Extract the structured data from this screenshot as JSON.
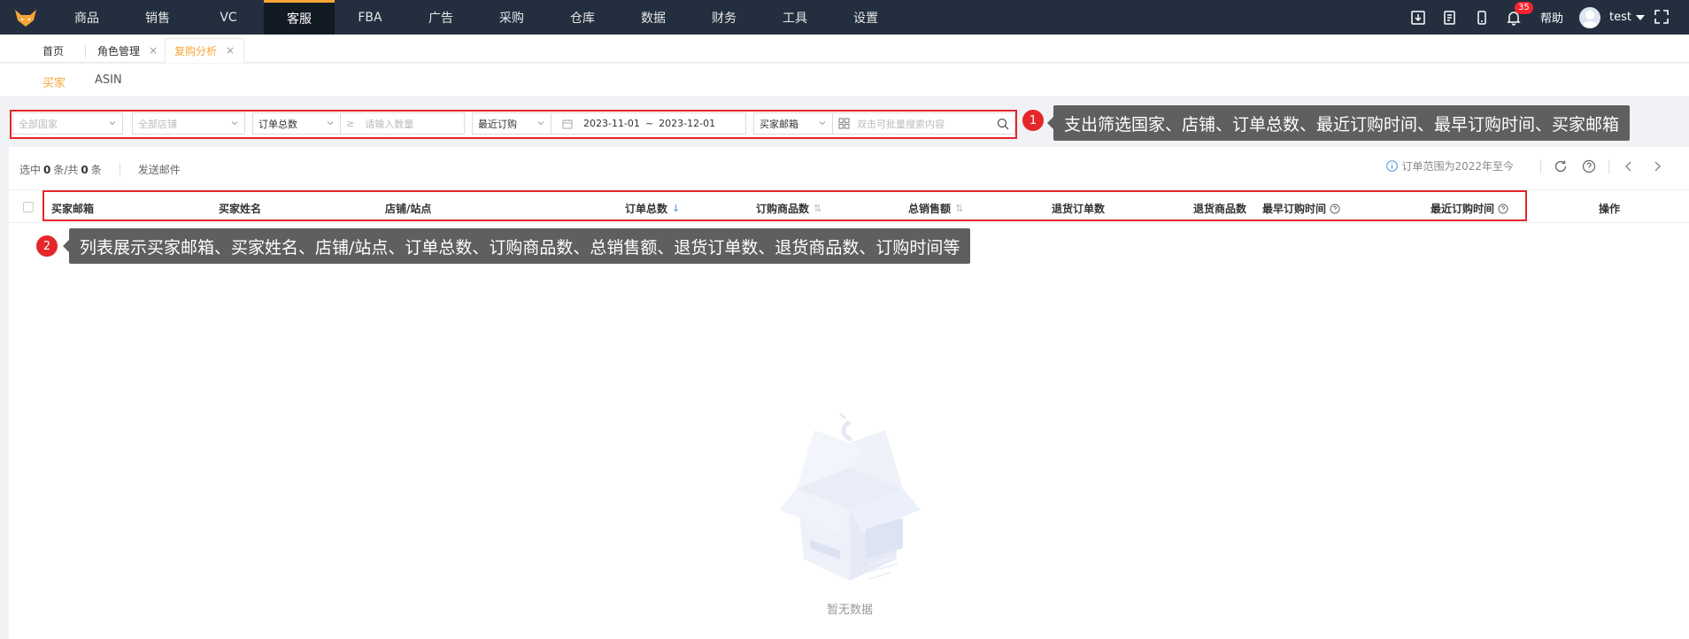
{
  "topnav": {
    "items": [
      {
        "label": "商品"
      },
      {
        "label": "销售"
      },
      {
        "label": "VC"
      },
      {
        "label": "客服",
        "active": true
      },
      {
        "label": "FBA"
      },
      {
        "label": "广告"
      },
      {
        "label": "采购"
      },
      {
        "label": "仓库"
      },
      {
        "label": "数据"
      },
      {
        "label": "财务"
      },
      {
        "label": "工具"
      },
      {
        "label": "设置"
      }
    ],
    "notification_count": "35",
    "help_label": "帮助",
    "username": "test",
    "accent_color": "#f7a535",
    "bg_color": "#232f3e"
  },
  "tabs": {
    "home": "首页",
    "role": "角色管理",
    "repurchase": "复购分析",
    "close_glyph": "×"
  },
  "subtabs": {
    "buyer": "买家",
    "asin": "ASIN"
  },
  "filters": {
    "country_placeholder": "全部国家",
    "store_placeholder": "全部店铺",
    "order_total": "订单总数",
    "gte": "≥",
    "quantity_placeholder": "请输入数量",
    "recent_purchase": "最近订购",
    "date_start": "2023-11-01",
    "date_sep": "~",
    "date_end": "2023-12-01",
    "buyer_email": "买家邮箱",
    "search_placeholder": "双击可批量搜索内容"
  },
  "annotations": {
    "one_number": "1",
    "one_text": "支出筛选国家、店铺、订单总数、最近订购时间、最早订购时间、买家邮箱",
    "two_number": "2",
    "two_text": "列表展示买家邮箱、买家姓名、店铺/站点、订单总数、订购商品数、总销售额、退货订单数、退货商品数、订购时间等",
    "color": "#e5262b"
  },
  "toolbar": {
    "selected_prefix": "选中",
    "selected_count": "0",
    "selected_mid": "条/共",
    "total_count": "0",
    "selected_suffix": "条",
    "send_email": "发送邮件",
    "range_info": "订单范围为2022年至今"
  },
  "table": {
    "columns": {
      "email": "买家邮箱",
      "name": "买家姓名",
      "store": "店铺/站点",
      "orders": "订单总数",
      "items": "订购商品数",
      "sales": "总销售额",
      "return_orders": "退货订单数",
      "return_items": "退货商品数",
      "earliest": "最早订购时间",
      "latest": "最近订购时间",
      "action": "操作"
    },
    "empty_text": "暂无数据"
  }
}
